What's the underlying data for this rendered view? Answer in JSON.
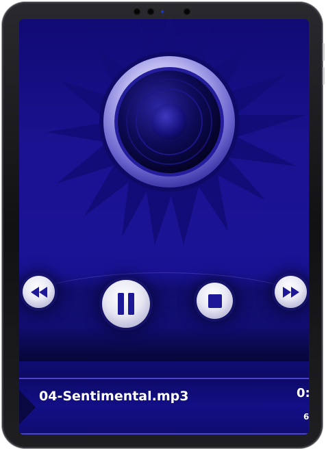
{
  "player": {
    "track_name": "04-Sentimental.mp3",
    "current_time": "0:",
    "total_time": "6"
  },
  "controls": {
    "rewind": "rewind-icon",
    "pause": "pause-icon",
    "stop": "stop-icon",
    "fast_forward": "fast-forward-icon"
  },
  "colors": {
    "background": "#1a1395",
    "accent": "#4b46c9",
    "button_face": "#e8e8f4",
    "icon": "#1c1896",
    "text": "#ffffff"
  }
}
